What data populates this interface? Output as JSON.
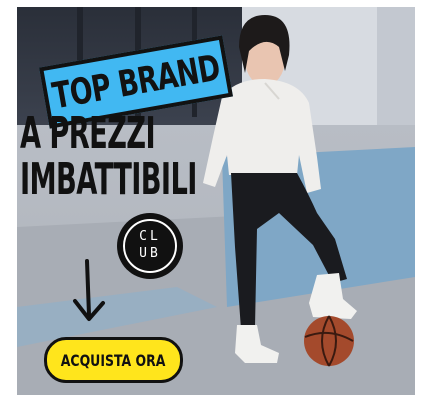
{
  "ad": {
    "headline": "TOP BRAND",
    "tagline_lines": [
      "A PREZZI",
      "IMBATTIBILI"
    ],
    "badge": {
      "top": "CL",
      "bottom": "UB"
    },
    "cta_label": "ACQUISTA ORA"
  },
  "colors": {
    "headline_bg": "#41b8f2",
    "cta_bg": "#ffe51c",
    "ink": "#111111"
  },
  "icons": [
    "down-arrow-icon",
    "club-logo-icon"
  ]
}
